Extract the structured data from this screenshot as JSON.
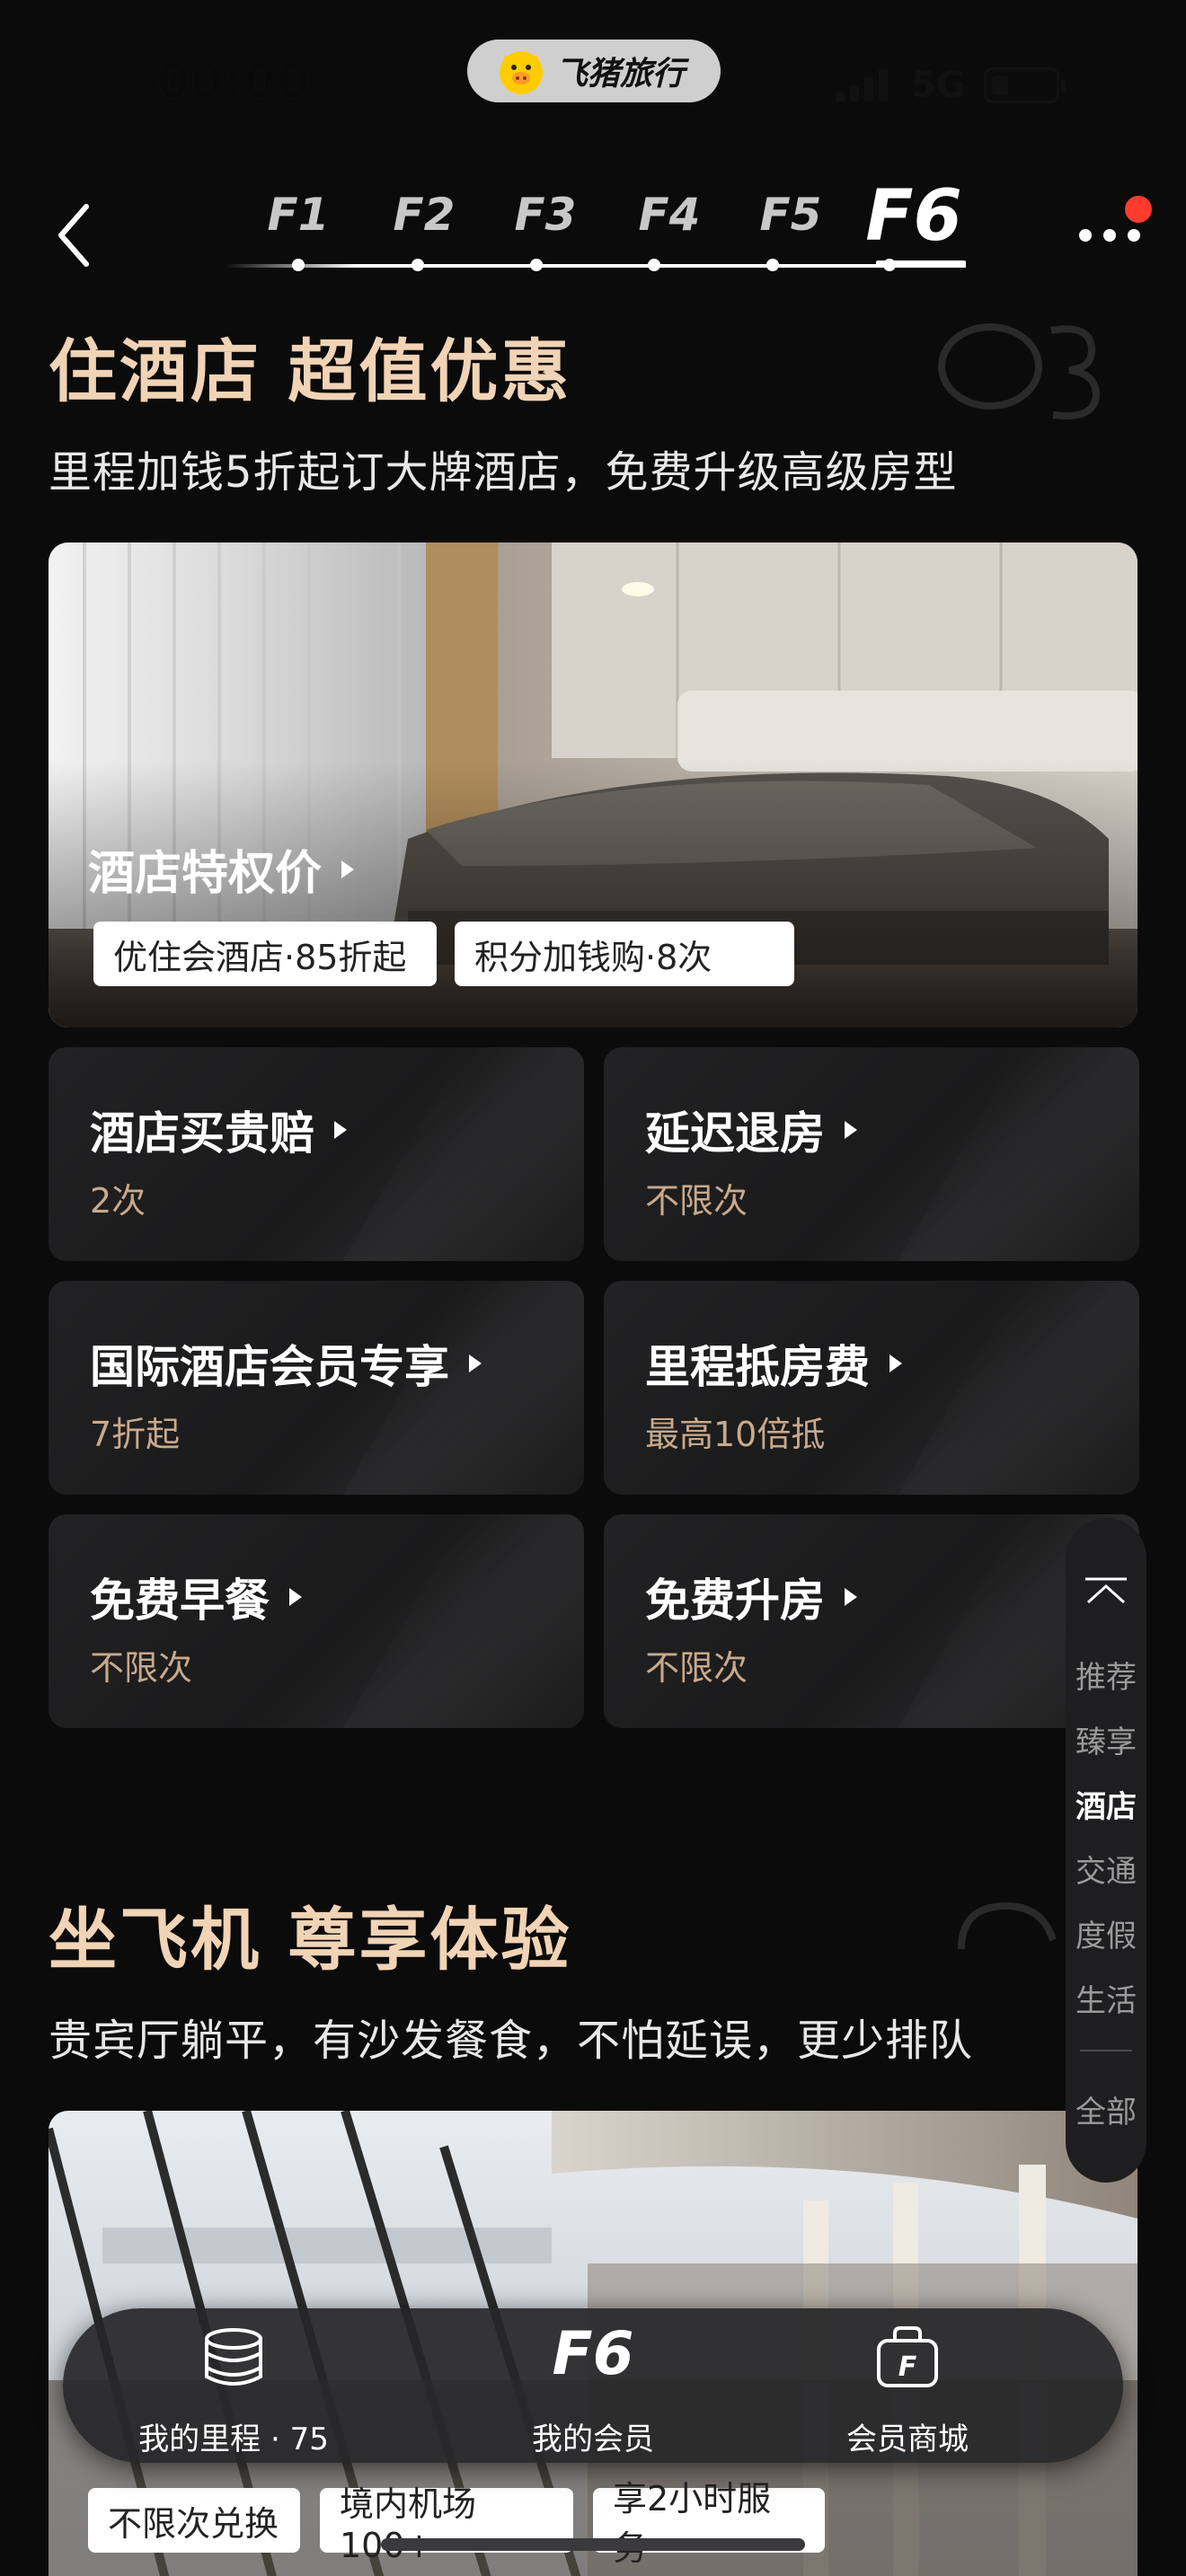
{
  "status_bar": {
    "time": "00:00",
    "app_name": "飞猪旅行",
    "network": "5G"
  },
  "nav": {
    "tabs": [
      "F1",
      "F2",
      "F3",
      "F4",
      "F5",
      "F6"
    ],
    "active_tab": "F6"
  },
  "hotel_section": {
    "title": "住酒店 超值优惠",
    "subtitle": "里程加钱5折起订大牌酒店，免费升级高级房型",
    "hero": {
      "label": "酒店特权价",
      "chips": [
        "优住会酒店·85折起",
        "积分加钱购·8次"
      ]
    },
    "cards": [
      {
        "title": "酒店买贵赔",
        "sub": "2次"
      },
      {
        "title": "延迟退房",
        "sub": "不限次"
      },
      {
        "title": "国际酒店会员专享",
        "sub": "7折起"
      },
      {
        "title": "里程抵房费",
        "sub": "最高10倍抵"
      },
      {
        "title": "免费早餐",
        "sub": "不限次"
      },
      {
        "title": "免费升房",
        "sub": "不限次"
      }
    ]
  },
  "flight_section": {
    "title": "坐飞机 尊享体验",
    "subtitle": "贵宾厅躺平，有沙发餐食，不怕延误，更少排队",
    "chips": [
      "不限次兑换",
      "境内机场100+",
      "享2小时服务"
    ]
  },
  "side_index": {
    "items": [
      "推荐",
      "臻享",
      "酒店",
      "交通",
      "度假",
      "生活"
    ],
    "active": "酒店",
    "all_label": "全部"
  },
  "bottom_nav": {
    "miles_label": "我的里程 · 75",
    "member_logo": "F6",
    "member_label": "我的会员",
    "mall_label": "会员商城"
  },
  "colors": {
    "accent_gold": "#f1d3b5",
    "sub_gold": "#c9a98a",
    "background": "#0b0b0c",
    "notification": "#ff3b30"
  }
}
